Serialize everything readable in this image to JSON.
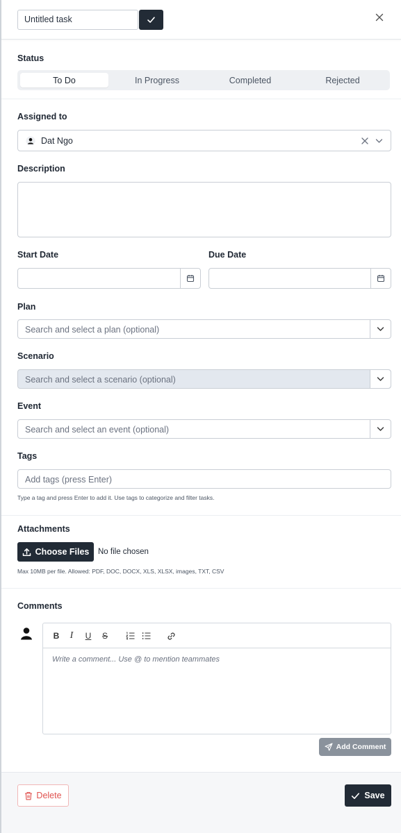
{
  "header": {
    "task_title_value": "Untitled task"
  },
  "status": {
    "label": "Status",
    "options": [
      "To Do",
      "In Progress",
      "Completed",
      "Rejected"
    ],
    "selected": "To Do"
  },
  "assigned": {
    "label": "Assigned to",
    "value": "Dat Ngo"
  },
  "description": {
    "label": "Description",
    "value": ""
  },
  "dates": {
    "start_label": "Start Date",
    "due_label": "Due Date",
    "start_value": "",
    "due_value": ""
  },
  "plan": {
    "label": "Plan",
    "placeholder": "Search and select a plan (optional)"
  },
  "scenario": {
    "label": "Scenario",
    "placeholder": "Search and select a scenario (optional)"
  },
  "event": {
    "label": "Event",
    "placeholder": "Search and select an event (optional)"
  },
  "tags": {
    "label": "Tags",
    "placeholder": "Add tags (press Enter)",
    "hint": "Type a tag and press Enter to add it. Use tags to categorize and filter tasks."
  },
  "attachments": {
    "label": "Attachments",
    "button_label": "Choose Files",
    "file_status": "No file chosen",
    "hint": "Max 10MB per file. Allowed: PDF, DOC, DOCX, XLS, XLSX, images, TXT, CSV"
  },
  "comments": {
    "label": "Comments",
    "placeholder": "Write a comment... Use @ to mention teammates",
    "toolbar": {
      "bold": "B",
      "italic": "I",
      "underline": "U",
      "strike": "S"
    },
    "add_button_label": "Add Comment"
  },
  "footer": {
    "delete_label": "Delete",
    "save_label": "Save"
  },
  "colors": {
    "primary": "#222b36",
    "danger": "#e0524f",
    "disabled_field": "#e3e8ef"
  }
}
